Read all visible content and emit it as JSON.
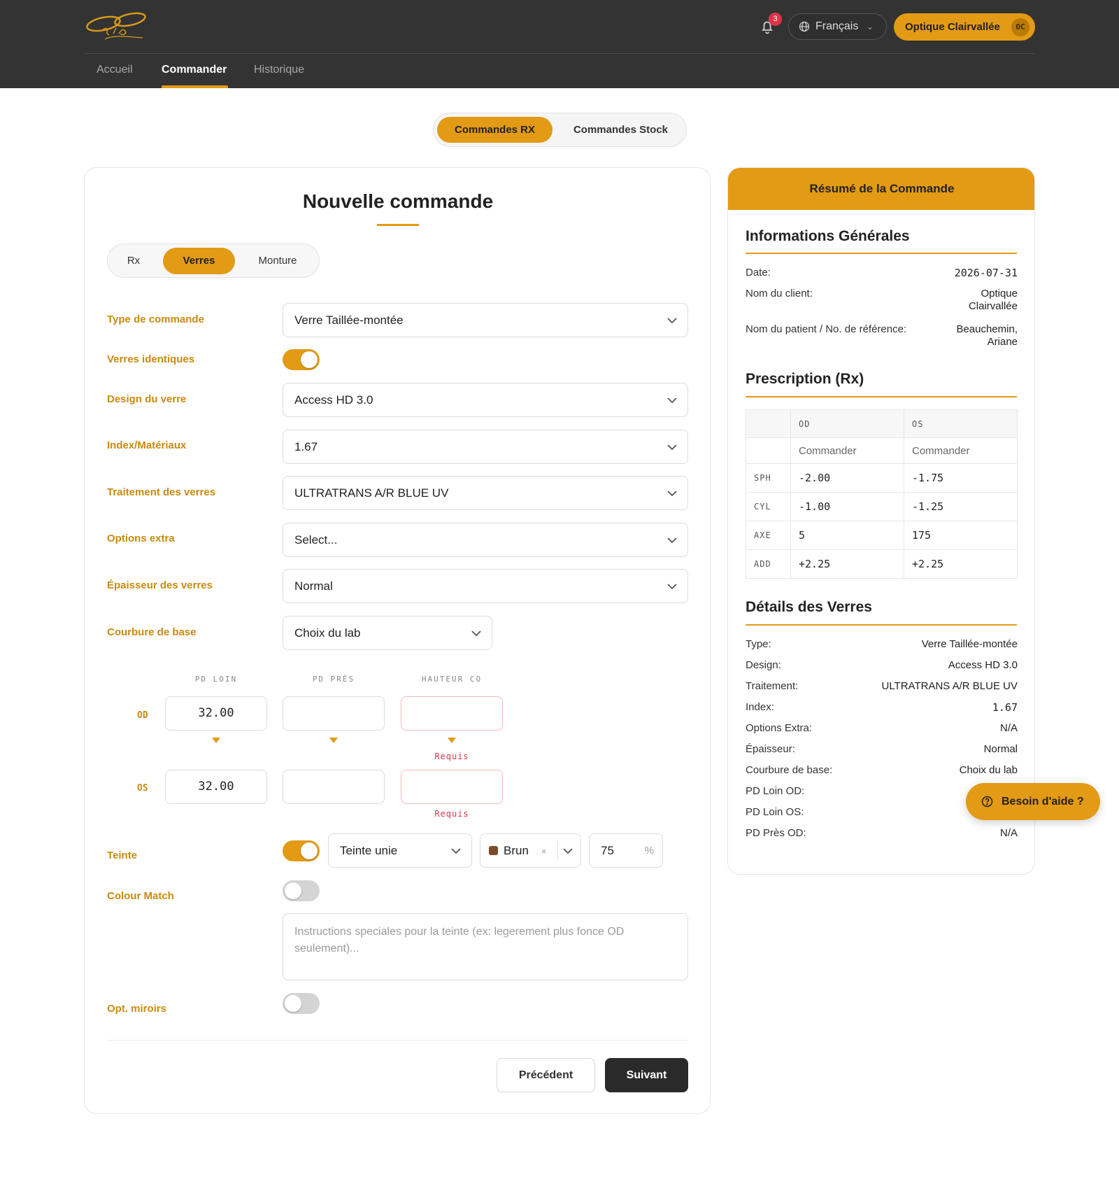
{
  "header": {
    "notifications_count": "3",
    "language": "Français",
    "account": {
      "name": "Optique Clairvallée",
      "initials": "OC"
    },
    "nav": [
      {
        "label": "Accueil",
        "active": false
      },
      {
        "label": "Commander",
        "active": true
      },
      {
        "label": "Historique",
        "active": false
      }
    ],
    "colors": {
      "bar": "#333333",
      "accent": "#e39a14"
    }
  },
  "order_type_toggle": [
    {
      "label": "Commandes RX",
      "selected": true
    },
    {
      "label": "Commandes Stock",
      "selected": false
    }
  ],
  "form": {
    "title": "Nouvelle commande",
    "steps": [
      {
        "label": "Rx",
        "selected": false
      },
      {
        "label": "Verres",
        "selected": true
      },
      {
        "label": "Monture",
        "selected": false
      }
    ],
    "fields": {
      "type_commande": {
        "label": "Type de commande",
        "value": "Verre Taillée-montée"
      },
      "verres_identiques": {
        "label": "Verres identiques",
        "on": true
      },
      "design": {
        "label": "Design du verre",
        "value": "Access HD 3.0"
      },
      "index": {
        "label": "Index/Matériaux",
        "value": "1.67"
      },
      "traitement": {
        "label": "Traitement des verres",
        "value": "ULTRATRANS A/R BLUE UV"
      },
      "options_extra": {
        "label": "Options extra",
        "value": "Select..."
      },
      "epaisseur": {
        "label": "Épaisseur des verres",
        "value": "Normal"
      },
      "courbure": {
        "label": "Courbure de base",
        "value": "Choix du lab"
      }
    },
    "measurements": {
      "columns": [
        "PD LOIN",
        "PD PRÈS",
        "HAUTEUR CO"
      ],
      "rows": [
        {
          "eye": "OD",
          "pd_loin": "32.00",
          "pd_pres": "",
          "hauteur": "",
          "hauteur_error": "Requis"
        },
        {
          "eye": "OS",
          "pd_loin": "32.00",
          "pd_pres": "",
          "hauteur": "",
          "hauteur_error": "Requis"
        }
      ]
    },
    "teinte": {
      "label": "Teinte",
      "on": true,
      "type": "Teinte unie",
      "color": "Brun",
      "color_clear": "×",
      "percent": "75",
      "percent_unit": "%"
    },
    "colour_match": {
      "label": "Colour Match",
      "on": false
    },
    "instructions_placeholder": "Instructions speciales pour la teinte (ex: legerement plus fonce OD seulement)...",
    "miroirs": {
      "label": "Opt. miroirs",
      "on": false
    },
    "buttons": {
      "prev": "Précédent",
      "next": "Suivant"
    }
  },
  "summary": {
    "title": "Résumé de la Commande",
    "general": {
      "heading": "Informations Générales",
      "rows": [
        {
          "k": "Date:",
          "v": "2026-07-31"
        },
        {
          "k": "Nom du client:",
          "v1": "Optique",
          "v2": "Clairvallée"
        },
        {
          "k": "Nom du patient / No. de référence:",
          "v1": "Beauchemin,",
          "v2": "Ariane"
        }
      ]
    },
    "prescription": {
      "heading": "Prescription (Rx)",
      "cols": [
        "OD",
        "OS"
      ],
      "sub": [
        "Commander",
        "Commander"
      ],
      "rows": [
        {
          "label": "SPH",
          "od": "-2.00",
          "os": "-1.75"
        },
        {
          "label": "CYL",
          "od": "-1.00",
          "os": "-1.25"
        },
        {
          "label": "AXE",
          "od": "5",
          "os": "175"
        },
        {
          "label": "ADD",
          "od": "+2.25",
          "os": "+2.25"
        }
      ]
    },
    "lenses": {
      "heading": "Détails des Verres",
      "rows": [
        {
          "k": "Type:",
          "v": "Verre Taillée-montée"
        },
        {
          "k": "Design:",
          "v": "Access HD 3.0"
        },
        {
          "k": "Traitement:",
          "v": "ULTRATRANS A/R BLUE UV"
        },
        {
          "k": "Index:",
          "v": "1.67"
        },
        {
          "k": "Options Extra:",
          "v": "N/A"
        },
        {
          "k": "Épaisseur:",
          "v": "Normal"
        },
        {
          "k": "Courbure de base:",
          "v": "Choix du lab"
        },
        {
          "k": "PD Loin OD:",
          "v": ""
        },
        {
          "k": "PD Loin OS:",
          "v": ""
        },
        {
          "k": "PD Près OD:",
          "v": "N/A"
        }
      ]
    }
  },
  "help_button": "Besoin d'aide ?"
}
